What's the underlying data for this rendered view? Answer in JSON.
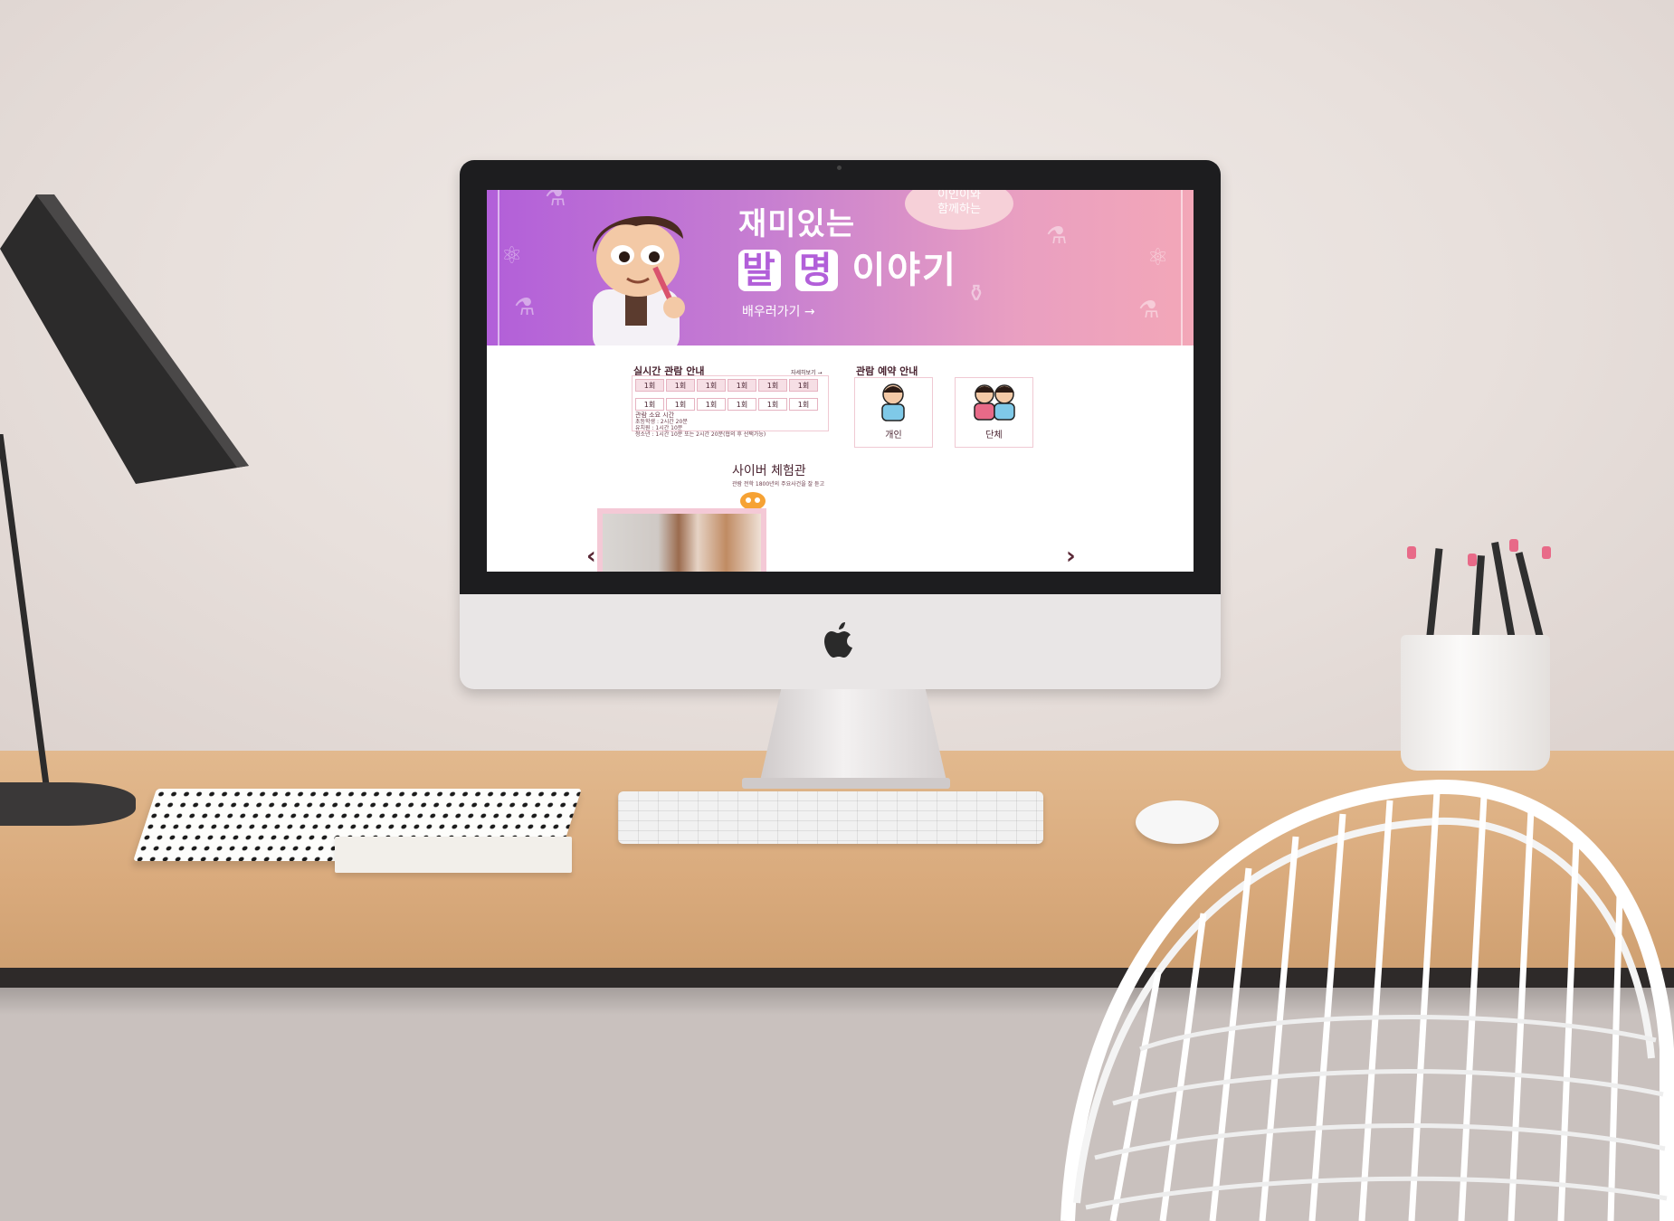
{
  "screen": {
    "banner": {
      "bubble": "이인이와\n함께하는",
      "title_line1": "재미있는",
      "title_highlight1": "발",
      "title_highlight2": "명",
      "title_rest": "이야기",
      "cta": "배우러가기 →"
    },
    "live_info": {
      "title": "실시간 관람 안내",
      "more": "자세히보기 →",
      "row1": [
        "1회",
        "1회",
        "1회",
        "1회",
        "1회",
        "1회"
      ],
      "row2": [
        "1회",
        "1회",
        "1회",
        "1회",
        "1회",
        "1회"
      ],
      "duration_title": "관람 소요 시간",
      "lines": [
        "초등학생 : 2시간 20분",
        "유치원 : 1시간 10분",
        "청소년 : 1시간 10분 또는 2시간 20분(협의 후 선택가능)"
      ]
    },
    "reservation": {
      "title": "관람 예약 안내",
      "individual": "개인",
      "group": "단체"
    },
    "cyber": {
      "title": "사이버 체험관",
      "subtitle": "관람 전학 1800년의 주요사건을 잘 듣고"
    }
  },
  "colors": {
    "banner_start": "#b25fd9",
    "banner_end": "#f3a7b8",
    "text_dark": "#4a2431",
    "accent_pink": "#f0c9d3"
  }
}
